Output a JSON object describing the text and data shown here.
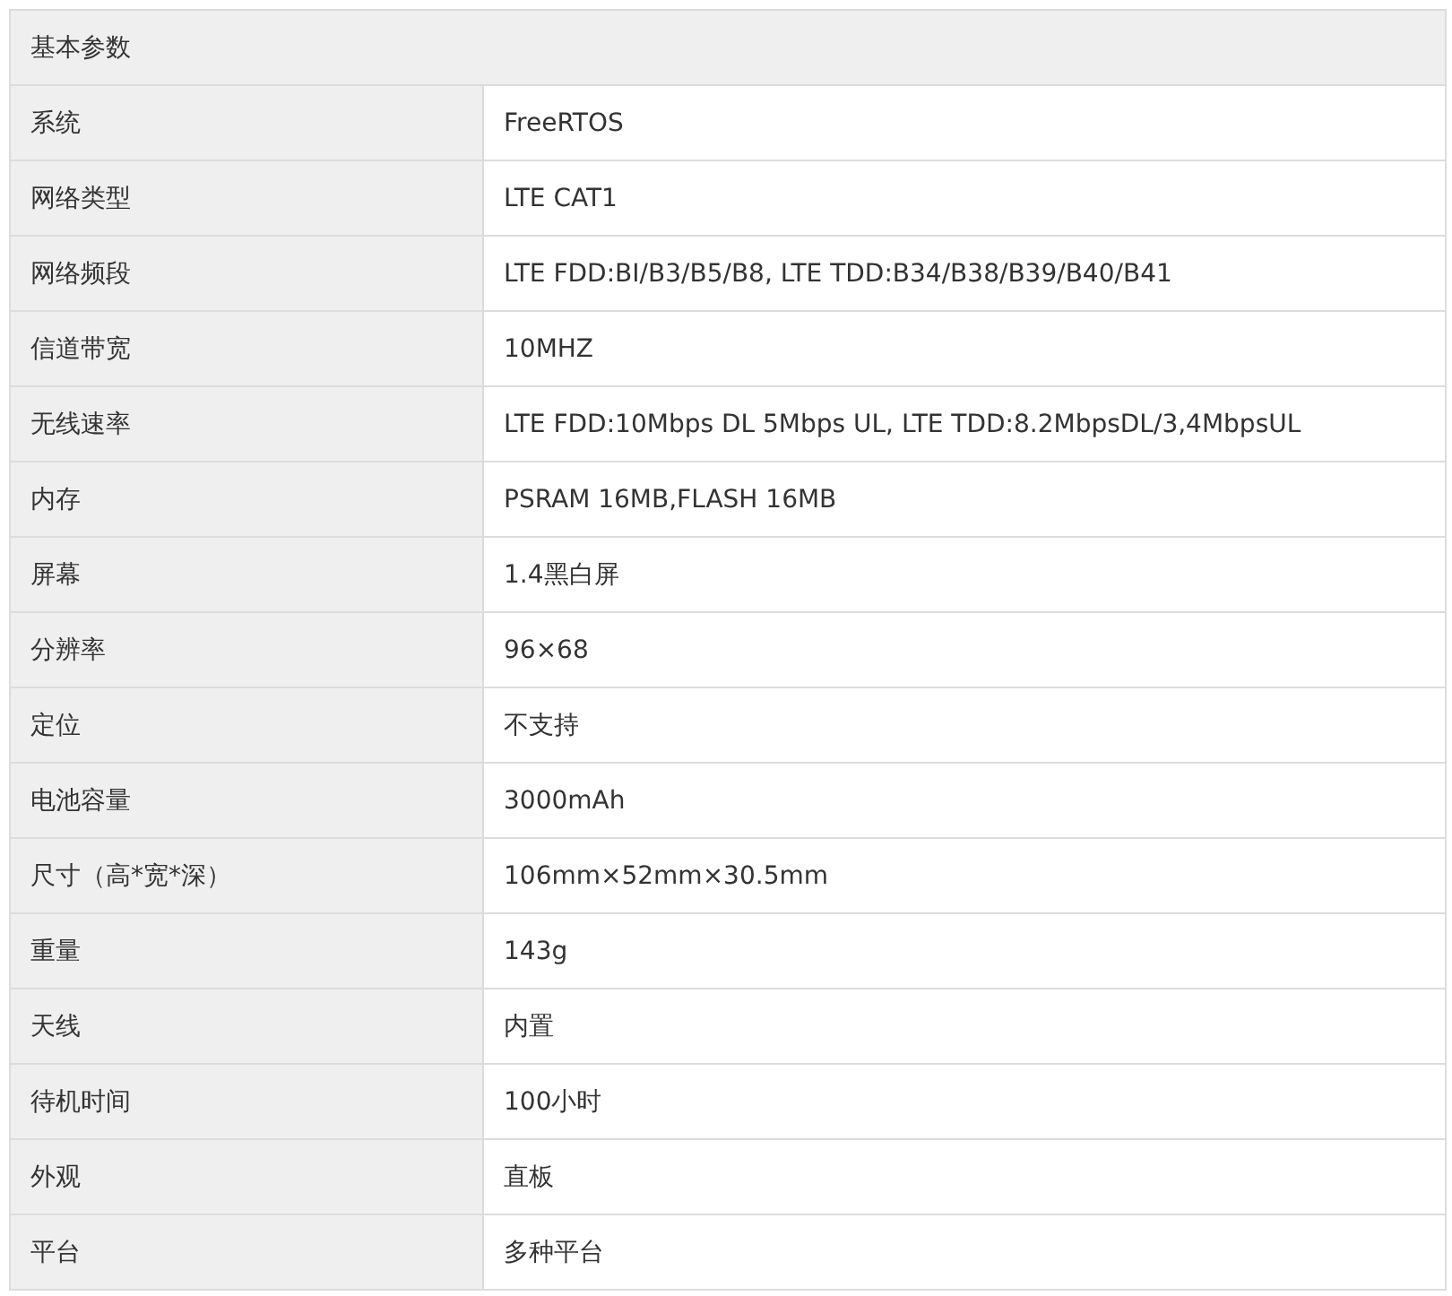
{
  "table": {
    "title": "基本参数",
    "rows": [
      {
        "label": "系统",
        "value": "FreeRTOS"
      },
      {
        "label": "网络类型",
        "value": "LTE CAT1"
      },
      {
        "label": "网络频段",
        "value": "LTE FDD:BI/B3/B5/B8, LTE TDD:B34/B38/B39/B40/B41"
      },
      {
        "label": "信道带宽",
        "value": "10MHZ"
      },
      {
        "label": "无线速率",
        "value": "LTE FDD:10Mbps DL 5Mbps UL, LTE TDD:8.2MbpsDL/3,4MbpsUL"
      },
      {
        "label": "内存",
        "value": "PSRAM 16MB,FLASH 16MB"
      },
      {
        "label": "屏幕",
        "value": "1.4黑白屏"
      },
      {
        "label": "分辨率",
        "value": "96×68"
      },
      {
        "label": "定位",
        "value": "不支持"
      },
      {
        "label": "电池容量",
        "value": "3000mAh"
      },
      {
        "label": "尺寸（高*宽*深）",
        "value": "106mm×52mm×30.5mm"
      },
      {
        "label": "重量",
        "value": "143g"
      },
      {
        "label": "天线",
        "value": "内置"
      },
      {
        "label": "待机时间",
        "value": "100小时"
      },
      {
        "label": "外观",
        "value": "直板"
      },
      {
        "label": "平台",
        "value": "多种平台"
      }
    ]
  }
}
